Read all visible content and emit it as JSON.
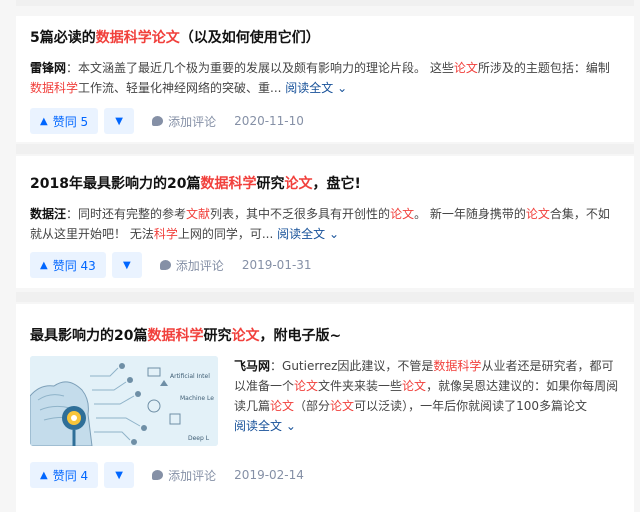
{
  "read_more_label": "阅读全文",
  "comment_label": "添加评论",
  "colors": {
    "highlight": "#f1403c",
    "vote": "#0066ff",
    "vote_bg": "#eaf3ff",
    "muted": "#8590a6"
  },
  "cards": [
    {
      "title": [
        "5篇必读的",
        "数据科学论文",
        "（以及如何使用它们）"
      ],
      "author": "雷锋网",
      "excerpt": [
        "：本文涵盖了最近几个极为重要的发展以及颇有影响力的理论片段。 这些",
        "论文",
        "所涉及的主题包括：编制",
        "数据科学",
        "工作流、轻量化神经网络的突破、重..."
      ],
      "votes": "赞同 5",
      "date": "2020-11-10"
    },
    {
      "title": [
        "2018年最具影响力的20篇",
        "数据科学",
        "研究",
        "论文",
        "，盘它!"
      ],
      "author": "数据汪",
      "excerpt": [
        "：同时还有完整的参考",
        "文献",
        "列表，其中不乏很多具有开创性的",
        "论文",
        "。 新一年随身携带的",
        "论文",
        "合集，不如就从这里开始吧！ 无法",
        "科学",
        "上网的同学，可..."
      ],
      "votes": "赞同 43",
      "date": "2019-01-31"
    },
    {
      "title": [
        "最具影响力的20篇",
        "数据科学",
        "研究",
        "论文",
        "，附电子版~"
      ],
      "author": "飞马网",
      "excerpt": [
        "：Gutierrez因此建议，不管是",
        "数据科学",
        "从业者还是研究者，都可以准备一个",
        "论文",
        "文件夹来装一些",
        "论文",
        "，就像吴恩达建议的：如果你每周阅读几篇",
        "论文",
        "（部分",
        "论文",
        "可以泛读），一年后你就阅读了100多篇论文"
      ],
      "thumb_labels": [
        "Artificial Intel",
        "Machine Le",
        "Deep L"
      ],
      "votes": "赞同 4",
      "date": "2019-02-14"
    }
  ]
}
